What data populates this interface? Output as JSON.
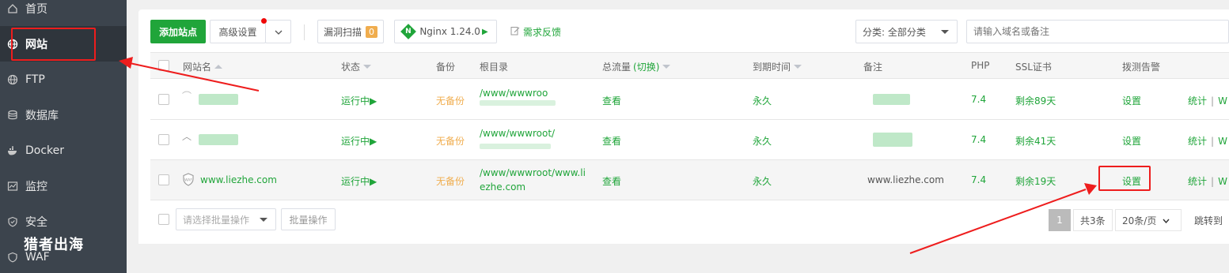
{
  "sidebar": {
    "items": [
      {
        "label": "首页",
        "icon": "home-icon"
      },
      {
        "label": "网站",
        "icon": "globe-icon",
        "active": true
      },
      {
        "label": "FTP",
        "icon": "ftp-icon"
      },
      {
        "label": "数据库",
        "icon": "database-icon"
      },
      {
        "label": "Docker",
        "icon": "docker-icon"
      },
      {
        "label": "监控",
        "icon": "monitor-icon"
      },
      {
        "label": "安全",
        "icon": "shield-icon"
      },
      {
        "label": "WAF",
        "icon": "waf-icon"
      }
    ],
    "watermark": "猎者出海"
  },
  "toolbar": {
    "add_site": "添加站点",
    "advanced": "高级设置",
    "vuln_scan": "漏洞扫描",
    "vuln_count": "0",
    "nginx": "Nginx 1.24.0",
    "feedback": "需求反馈",
    "category": "分类: 全部分类",
    "search_placeholder": "请输入域名或备注"
  },
  "table": {
    "headers": {
      "name": "网站名",
      "status": "状态",
      "backup": "备份",
      "root": "根目录",
      "traffic": "总流量",
      "traffic_switch": "(切换)",
      "expire": "到期时间",
      "note": "备注",
      "php": "PHP",
      "ssl": "SSL证书",
      "alert": "拨测告警"
    },
    "rows": [
      {
        "name": "",
        "status": "运行中▶",
        "backup": "无备份",
        "root_line1": "/www/wwwroo",
        "root_line2": "",
        "traffic": "查看",
        "expire": "永久",
        "note": "",
        "php": "7.4",
        "ssl": "剩余89天",
        "alert": "设置",
        "stats": "统计",
        "more": "W"
      },
      {
        "name": "",
        "status": "运行中▶",
        "backup": "无备份",
        "root_line1": "/www/wwwroot/",
        "root_line2": "",
        "traffic": "查看",
        "expire": "永久",
        "note": "",
        "php": "7.4",
        "ssl": "剩余41天",
        "alert": "设置",
        "stats": "统计",
        "more": "W"
      },
      {
        "name": "www.liezhe.com",
        "status": "运行中▶",
        "backup": "无备份",
        "root_line1": "/www/wwwroot/www.li",
        "root_line2": "ezhe.com",
        "traffic": "查看",
        "expire": "永久",
        "note": "www.liezhe.com",
        "php": "7.4",
        "ssl": "剩余19天",
        "alert": "设置",
        "stats": "统计",
        "more": "W"
      }
    ]
  },
  "footer": {
    "batch_placeholder": "请选择批量操作",
    "batch_button": "批量操作",
    "page": "1",
    "total": "共3条",
    "per_page": "20条/页",
    "jump": "跳转到"
  },
  "colors": {
    "accent": "#20a53a",
    "sidebar_bg": "#3c444d",
    "annotation": "#ee1d1d",
    "warning": "#f0ad4e"
  }
}
